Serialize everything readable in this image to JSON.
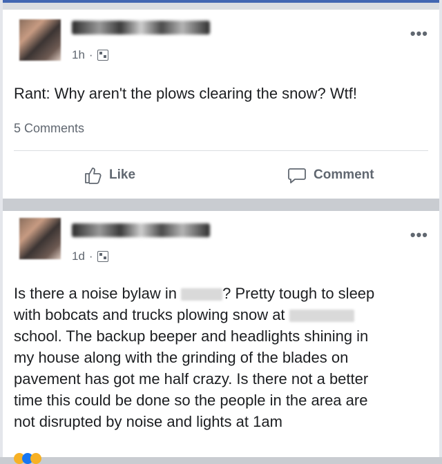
{
  "posts": [
    {
      "time": "1h",
      "separator": "·",
      "more": "•••",
      "text": "Rant: Why aren't the plows clearing the snow? Wtf!",
      "comments": "5 Comments",
      "like_label": "Like",
      "comment_label": "Comment"
    },
    {
      "time": "1d",
      "separator": "·",
      "more": "•••",
      "lines": [
        "Is there a noise bylaw in ",
        "? Pretty tough to sleep",
        "with bobcats and trucks plowing snow at ",
        "school. The backup beeper and headlights shining in",
        "my house along with the grinding of the blades on",
        "pavement has got me half crazy. Is there not a better",
        "time this could be done so the people in the area are",
        "not disrupted by noise and lights at 1am"
      ]
    }
  ],
  "colors": {
    "background": "#c9ccd1",
    "card": "#ffffff",
    "muted_text": "#606770",
    "accent": "#4267b2"
  },
  "icons": {
    "like": "thumbs-up-icon",
    "comment": "speech-bubble-icon",
    "privacy": "friends-icon",
    "more": "more-options-icon"
  }
}
